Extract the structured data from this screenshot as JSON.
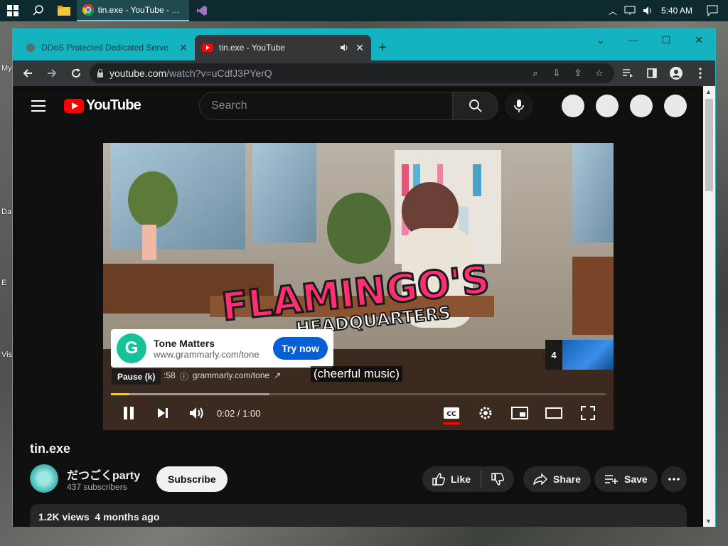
{
  "taskbar": {
    "active_app_title": "tin.exe - YouTube - G...",
    "clock": "5:40 AM"
  },
  "desktop": {
    "icon_labels": [
      "My",
      "Da",
      "E",
      "Vis"
    ]
  },
  "browser": {
    "tabs": [
      {
        "title": "DDoS Protected Dedicated Serve",
        "active": false
      },
      {
        "title": "tin.exe - YouTube",
        "active": true
      }
    ],
    "url_host": "youtube.com",
    "url_path": "/watch?v=uCdfJ3PYerQ"
  },
  "youtube": {
    "logo_text": "YouTube",
    "search_placeholder": "Search"
  },
  "player": {
    "ad": {
      "title": "Tone Matters",
      "domain": "www.grammarly.com/tone",
      "cta": "Try now",
      "logo_letter": "G"
    },
    "ad_meta_time": ":58",
    "ad_meta_link": "grammarly.com/tone",
    "skip_count": "4",
    "pause_tooltip": "Pause (k)",
    "caption": "(cheerful music)",
    "timecode": "0:02 / 1:00",
    "progress_played": 0.037,
    "progress_buffered": 0.32,
    "scene_title_line1": "FLAMINGO'S",
    "scene_title_line2": "HEADQUARTERS"
  },
  "video": {
    "title": "tin.exe",
    "channel_name": "だつごくparty",
    "subscribers": "437 subscribers",
    "subscribe_label": "Subscribe",
    "like_label": "Like",
    "share_label": "Share",
    "save_label": "Save",
    "views": "1.2K views",
    "age": "4 months ago"
  },
  "colors": {
    "yt_red": "#ff0000",
    "tab_strip": "#14b3c0",
    "ad_cta": "#065fd4",
    "progress_played": "#ffcc00"
  }
}
